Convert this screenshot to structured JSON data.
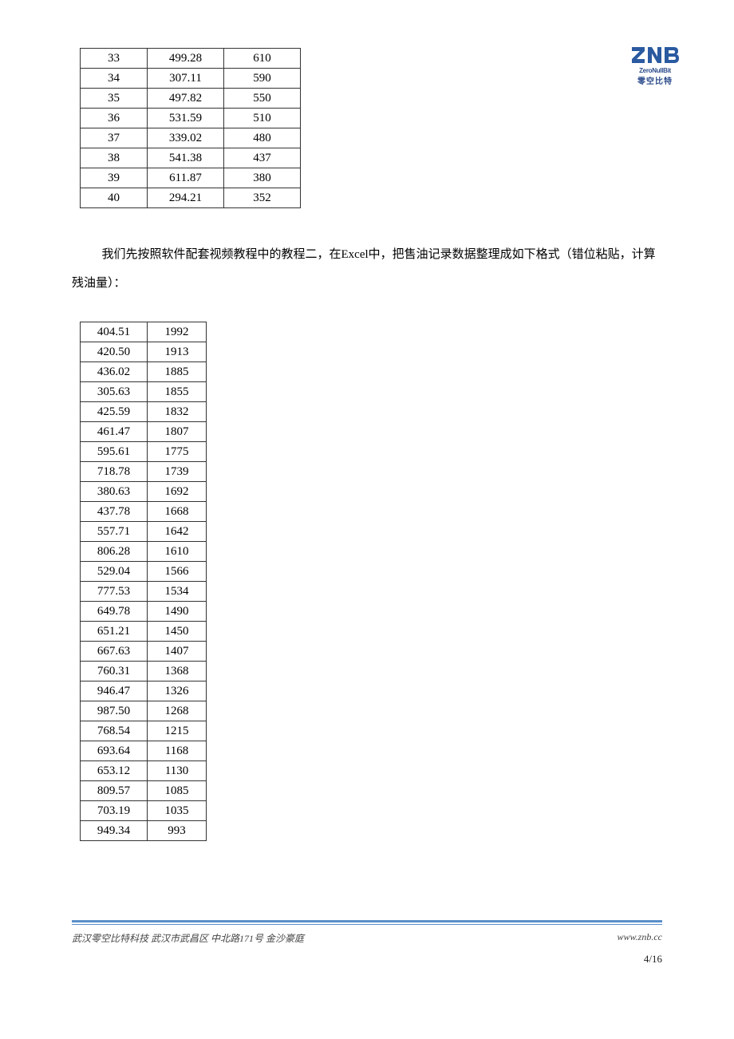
{
  "logo": {
    "main": "ZNB",
    "sub": "ZeroNullBit",
    "cn": "零空比特"
  },
  "table1": {
    "rows": [
      [
        "33",
        "499.28",
        "610"
      ],
      [
        "34",
        "307.11",
        "590"
      ],
      [
        "35",
        "497.82",
        "550"
      ],
      [
        "36",
        "531.59",
        "510"
      ],
      [
        "37",
        "339.02",
        "480"
      ],
      [
        "38",
        "541.38",
        "437"
      ],
      [
        "39",
        "611.87",
        "380"
      ],
      [
        "40",
        "294.21",
        "352"
      ]
    ]
  },
  "paragraph": "我们先按照软件配套视频教程中的教程二，在Excel中，把售油记录数据整理成如下格式（错位粘贴，计算残油量）：",
  "table2": {
    "rows": [
      [
        "404.51",
        "1992"
      ],
      [
        "420.50",
        "1913"
      ],
      [
        "436.02",
        "1885"
      ],
      [
        "305.63",
        "1855"
      ],
      [
        "425.59",
        "1832"
      ],
      [
        "461.47",
        "1807"
      ],
      [
        "595.61",
        "1775"
      ],
      [
        "718.78",
        "1739"
      ],
      [
        "380.63",
        "1692"
      ],
      [
        "437.78",
        "1668"
      ],
      [
        "557.71",
        "1642"
      ],
      [
        "806.28",
        "1610"
      ],
      [
        "529.04",
        "1566"
      ],
      [
        "777.53",
        "1534"
      ],
      [
        "649.78",
        "1490"
      ],
      [
        "651.21",
        "1450"
      ],
      [
        "667.63",
        "1407"
      ],
      [
        "760.31",
        "1368"
      ],
      [
        "946.47",
        "1326"
      ],
      [
        "987.50",
        "1268"
      ],
      [
        "768.54",
        "1215"
      ],
      [
        "693.64",
        "1168"
      ],
      [
        "653.12",
        "1130"
      ],
      [
        "809.57",
        "1085"
      ],
      [
        "703.19",
        "1035"
      ],
      [
        "949.34",
        "993"
      ]
    ]
  },
  "footer": {
    "left": "武汉零空比特科技 武汉市武昌区 中北路171号 金沙豪庭",
    "right": "www.znb.cc",
    "page": "4/16"
  }
}
